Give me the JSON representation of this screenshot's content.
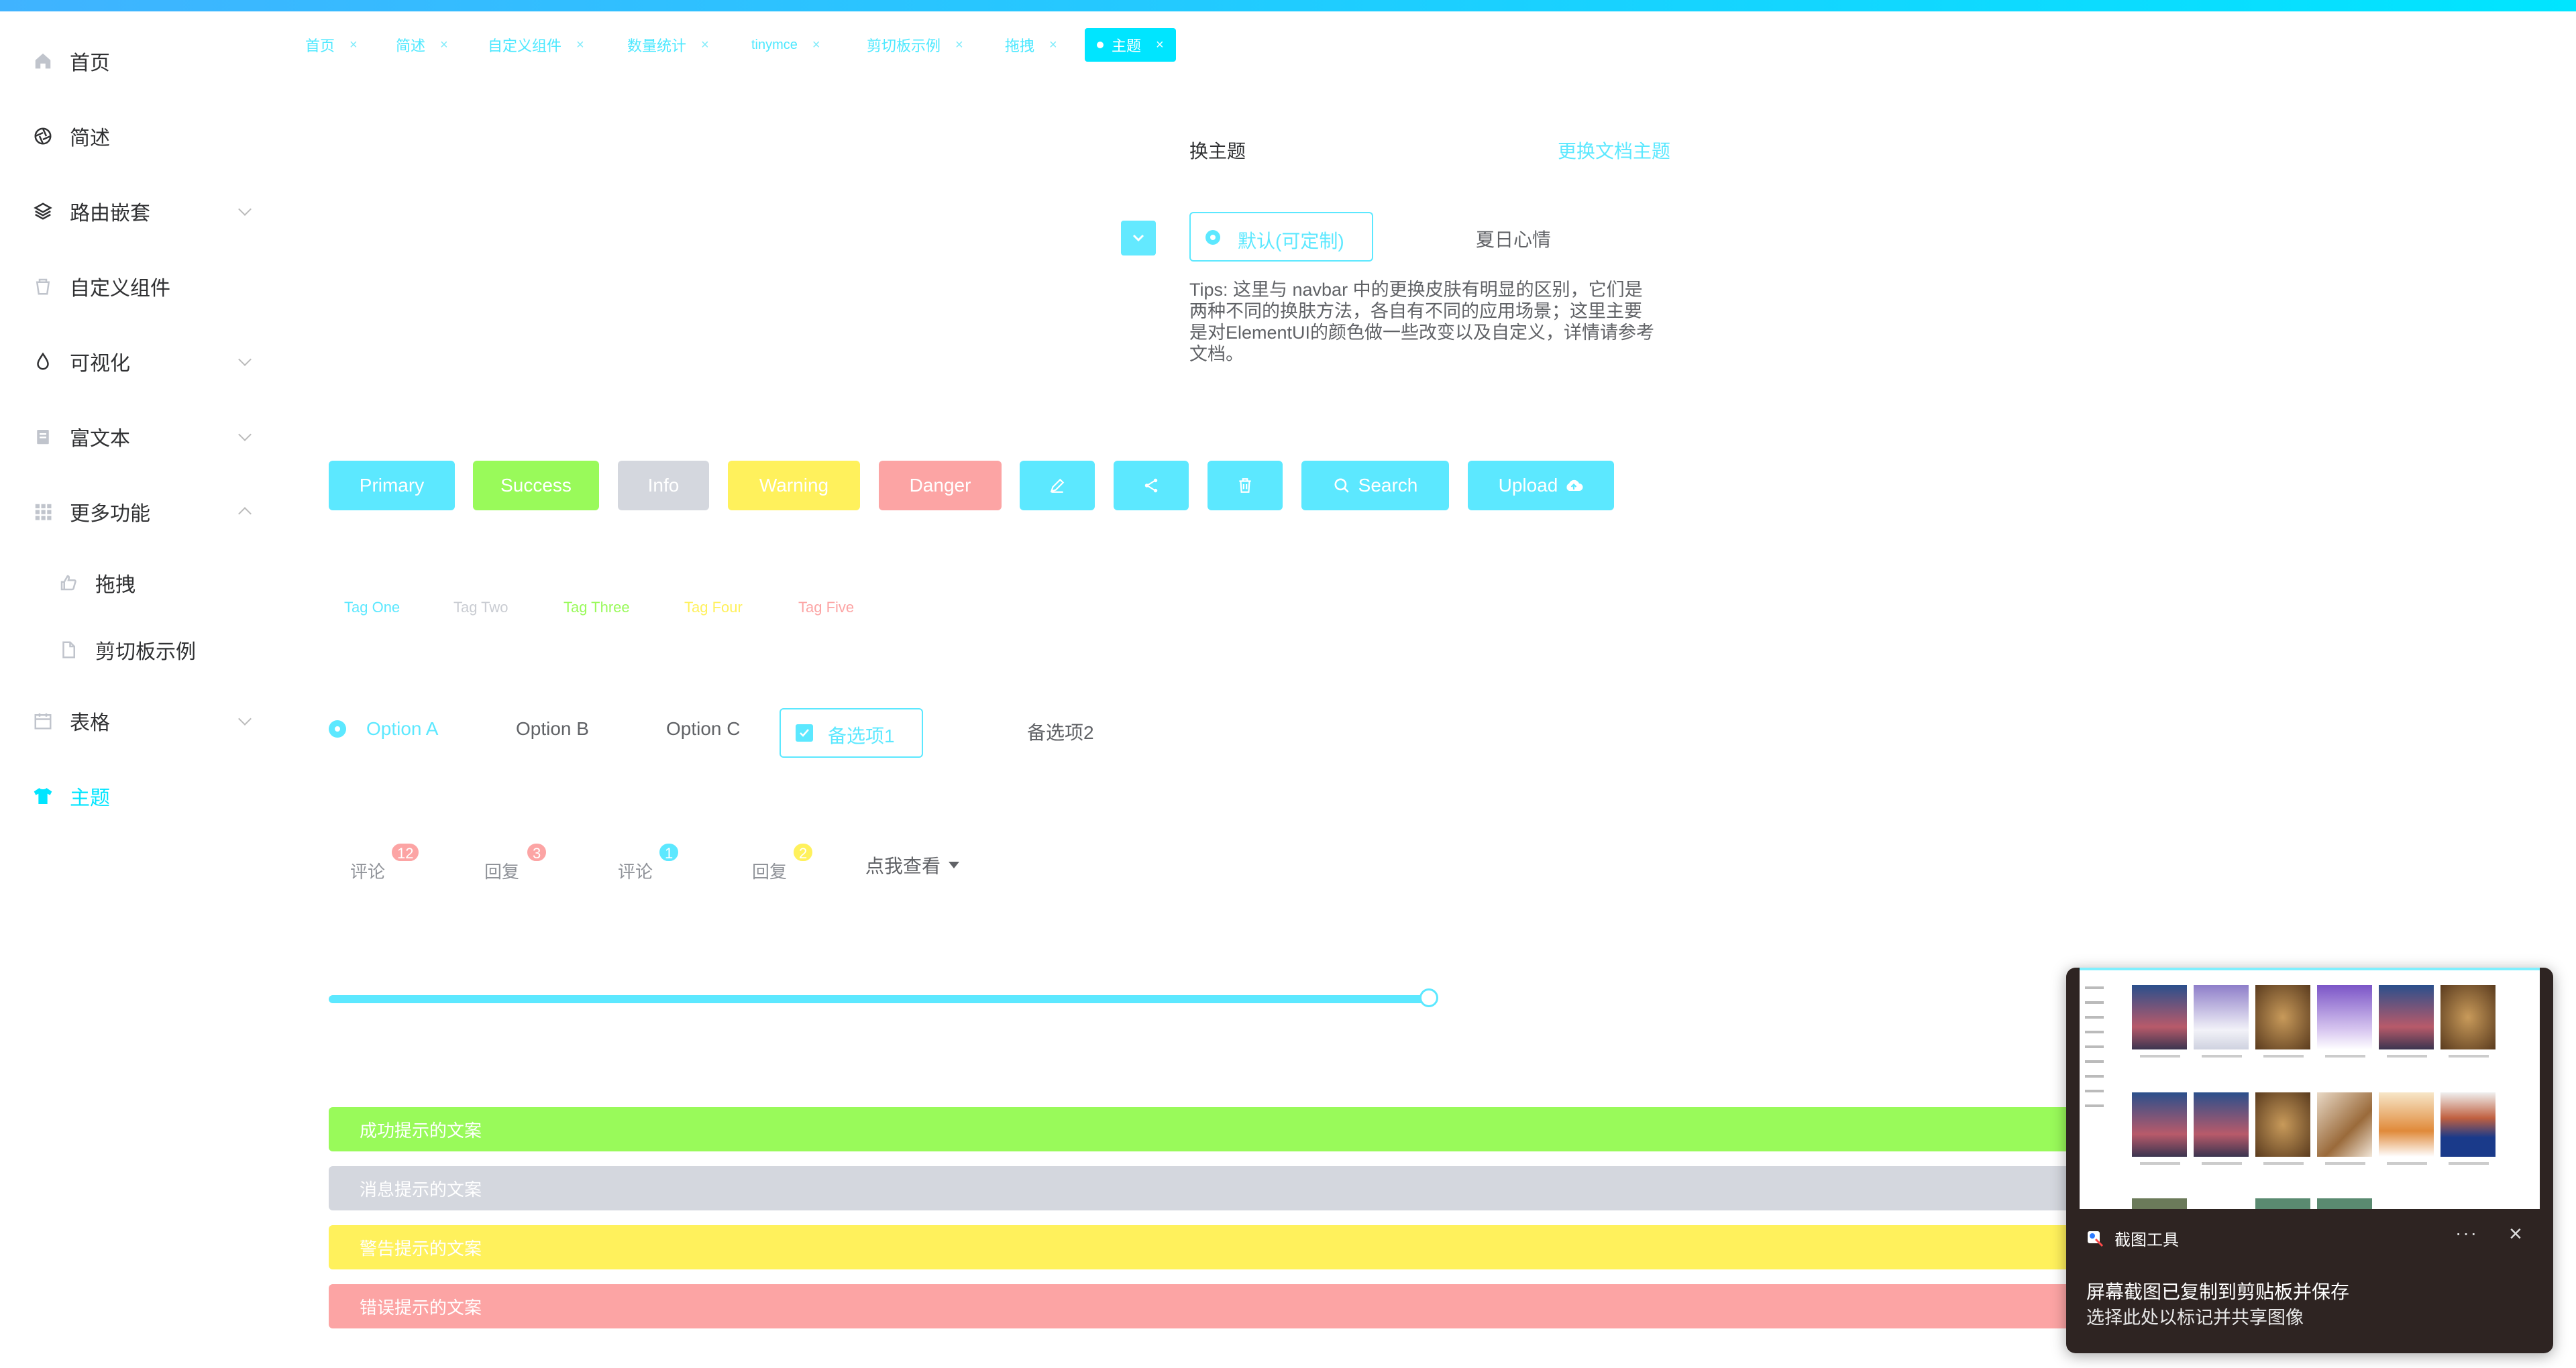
{
  "colors": {
    "primary": "#5ce8ff",
    "success": "#99fa5a",
    "info": "#d4d7de",
    "warning": "#fff15c",
    "danger": "#fca4a4",
    "accent": "#00e5ff",
    "toast_bg": "#2e2422"
  },
  "sidebar": {
    "items": [
      {
        "label": "首页",
        "icon": "home-icon"
      },
      {
        "label": "简述",
        "icon": "aperture-icon"
      },
      {
        "label": "路由嵌套",
        "icon": "layers-icon"
      },
      {
        "label": "自定义组件",
        "icon": "bucket-icon"
      },
      {
        "label": "可视化",
        "icon": "drop-icon"
      },
      {
        "label": "富文本",
        "icon": "notepad-icon"
      },
      {
        "label": "更多功能",
        "icon": "grid-icon"
      },
      {
        "label": "拖拽",
        "icon": "thumb-icon"
      },
      {
        "label": "剪切板示例",
        "icon": "document-icon"
      },
      {
        "label": "表格",
        "icon": "calendar-icon"
      },
      {
        "label": "主题",
        "icon": "tshirt-icon"
      }
    ]
  },
  "tabs": [
    {
      "label": "首页",
      "close": "×"
    },
    {
      "label": "简述",
      "close": "×"
    },
    {
      "label": "自定义组件",
      "close": "×"
    },
    {
      "label": "数量统计",
      "close": "×"
    },
    {
      "label": "tinymce",
      "close": "×"
    },
    {
      "label": "剪切板示例",
      "close": "×"
    },
    {
      "label": "拖拽",
      "close": "×"
    },
    {
      "label": "主题",
      "close": "×",
      "active": true
    }
  ],
  "theme": {
    "title": "换主题",
    "link": "更换文档主题",
    "radio_selected": "默认(可定制)",
    "radio_other": "夏日心情",
    "tips": "Tips: 这里与 navbar 中的更换皮肤有明显的区别，它们是两种不同的换肤方法，各自有不同的应用场景；这里主要是对ElementUI的颜色做一些改变以及自定义，详情请参考文档。"
  },
  "buttons": {
    "primary": "Primary",
    "success": "Success",
    "info": "Info",
    "warning": "Warning",
    "danger": "Danger",
    "search": "Search",
    "upload": "Upload"
  },
  "tags": [
    "Tag One",
    "Tag Two",
    "Tag Three",
    "Tag Four",
    "Tag Five"
  ],
  "radios": {
    "a": "Option A",
    "b": "Option B",
    "c": "Option C"
  },
  "checkboxes": {
    "one": "备选项1",
    "two": "备选项2"
  },
  "badges": [
    {
      "label": "评论",
      "count": "12"
    },
    {
      "label": "回复",
      "count": "3"
    },
    {
      "label": "评论",
      "count": "1"
    },
    {
      "label": "回复",
      "count": "2"
    }
  ],
  "dropdown": {
    "label": "点我查看"
  },
  "slider": {
    "value_percent": 100
  },
  "alerts": {
    "success": "成功提示的文案",
    "info": "消息提示的文案",
    "warning": "警告提示的文案",
    "error": "错误提示的文案"
  },
  "toast": {
    "app_name": "截图工具",
    "more": "···",
    "close": "×",
    "line1": "屏幕截图已复制到剪贴板并保存",
    "line2": "选择此处以标记并共享图像"
  }
}
